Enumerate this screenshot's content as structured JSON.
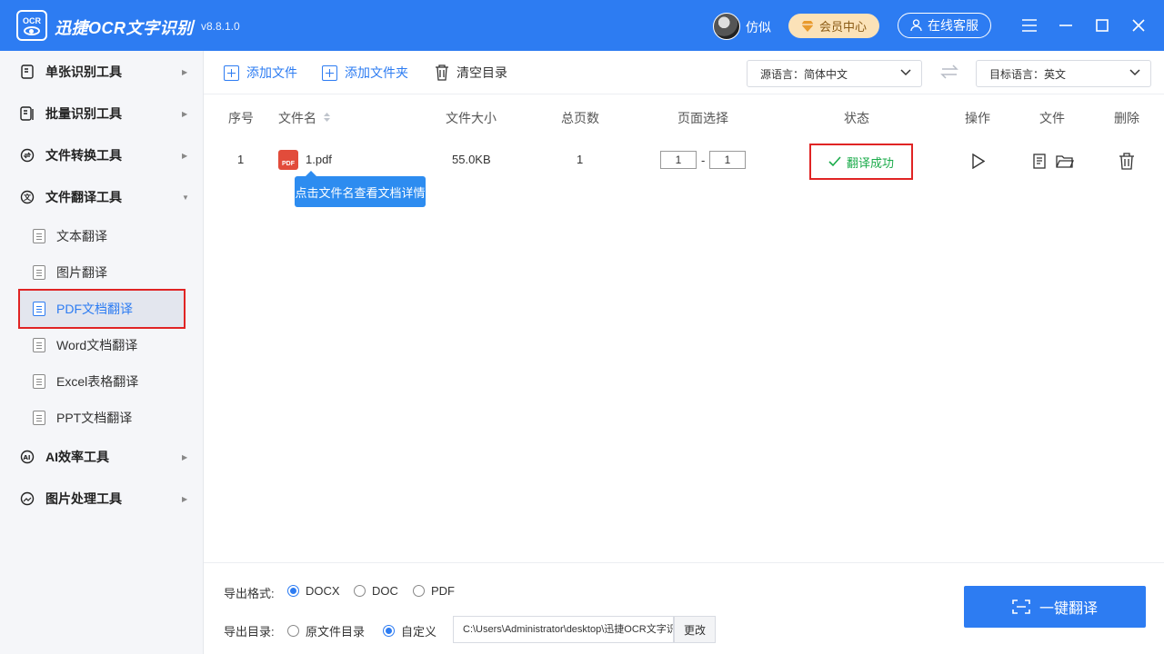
{
  "titlebar": {
    "logo_text": "OCR",
    "app_name": "迅捷OCR文字识别",
    "version": "v8.8.1.0",
    "username": "仿似",
    "vip_label": "会员中心",
    "service_label": "在线客服"
  },
  "sidebar": {
    "categories": [
      {
        "label": "单张识别工具"
      },
      {
        "label": "批量识别工具"
      },
      {
        "label": "文件转换工具"
      },
      {
        "label": "文件翻译工具"
      },
      {
        "label": "AI效率工具"
      },
      {
        "label": "图片处理工具"
      }
    ],
    "translate_items": [
      {
        "label": "文本翻译"
      },
      {
        "label": "图片翻译"
      },
      {
        "label": "PDF文档翻译",
        "active": true
      },
      {
        "label": "Word文档翻译"
      },
      {
        "label": "Excel表格翻译"
      },
      {
        "label": "PPT文档翻译"
      }
    ]
  },
  "toolbar": {
    "add_file": "添加文件",
    "add_folder": "添加文件夹",
    "clear": "清空目录",
    "source_lang": "源语言：简体中文",
    "target_lang": "目标语言：英文"
  },
  "table": {
    "headers": {
      "index": "序号",
      "filename": "文件名",
      "size": "文件大小",
      "pages": "总页数",
      "page_select": "页面选择",
      "status": "状态",
      "action": "操作",
      "file": "文件",
      "delete": "删除"
    },
    "rows": [
      {
        "index": "1",
        "file_badge": "PDF",
        "filename": "1.pdf",
        "size": "55.0KB",
        "pages": "1",
        "page_from": "1",
        "page_sep": "-",
        "page_to": "1",
        "status": "翻译成功"
      }
    ],
    "tooltip": "点击文件名查看文档详情"
  },
  "footer": {
    "format_label": "导出格式:",
    "formats": [
      "DOCX",
      "DOC",
      "PDF"
    ],
    "selected_format": "DOCX",
    "dir_label": "导出目录:",
    "dir_options": [
      "原文件目录",
      "自定义"
    ],
    "selected_dir": "自定义",
    "path": "C:\\Users\\Administrator\\desktop\\迅捷OCR文字识别",
    "change_label": "更改",
    "translate_label": "一键翻译"
  },
  "colors": {
    "primary": "#2d7cf2",
    "success": "#1aab4a",
    "highlight_border": "#e02424"
  }
}
